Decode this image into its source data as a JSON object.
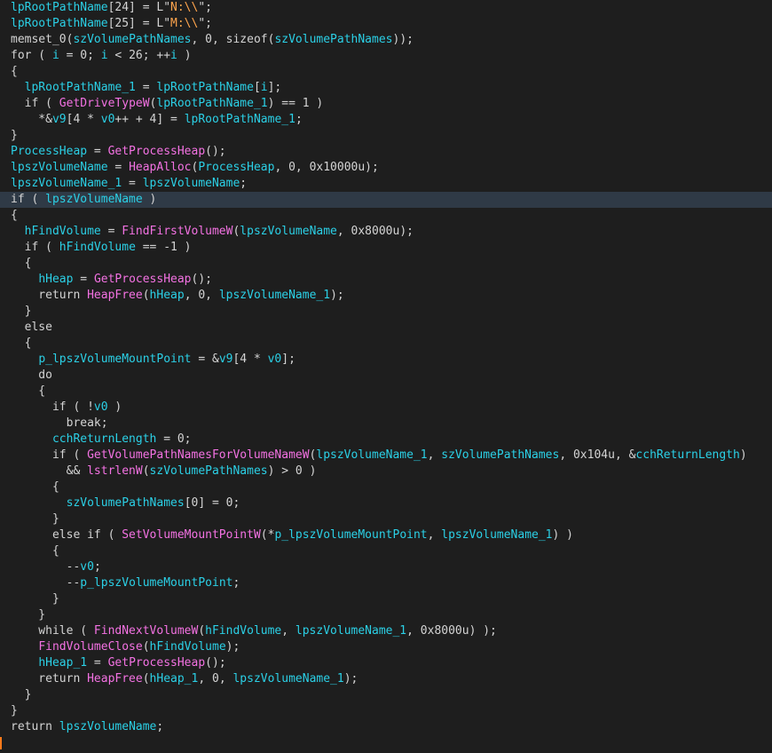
{
  "colors": {
    "background": "#1e1e1e",
    "current_line": "#2f3a46",
    "plain": "#d4d4d4",
    "variable": "#2bd0e6",
    "function": "#f472e3",
    "string": "#ffa54d",
    "caret": "#ff7a1a"
  },
  "current_line_index": 12,
  "code": {
    "lines": [
      [
        [
          "var",
          "lpRootPathName"
        ],
        [
          "plain",
          "[24] = L\""
        ],
        [
          "str",
          "N:\\\\"
        ],
        [
          "plain",
          "\";"
        ]
      ],
      [
        [
          "var",
          "lpRootPathName"
        ],
        [
          "plain",
          "[25] = L\""
        ],
        [
          "str",
          "M:\\\\"
        ],
        [
          "plain",
          "\";"
        ]
      ],
      [
        [
          "plain",
          "memset_0("
        ],
        [
          "var",
          "szVolumePathNames"
        ],
        [
          "plain",
          ", 0, sizeof("
        ],
        [
          "var",
          "szVolumePathNames"
        ],
        [
          "plain",
          "));"
        ]
      ],
      [
        [
          "plain",
          "for ( "
        ],
        [
          "var",
          "i"
        ],
        [
          "plain",
          " = 0; "
        ],
        [
          "var",
          "i"
        ],
        [
          "plain",
          " < 26; ++"
        ],
        [
          "var",
          "i"
        ],
        [
          "plain",
          " )"
        ]
      ],
      [
        [
          "plain",
          "{"
        ]
      ],
      [
        [
          "plain",
          "  "
        ],
        [
          "var",
          "lpRootPathName_1"
        ],
        [
          "plain",
          " = "
        ],
        [
          "var",
          "lpRootPathName"
        ],
        [
          "plain",
          "["
        ],
        [
          "var",
          "i"
        ],
        [
          "plain",
          "];"
        ]
      ],
      [
        [
          "plain",
          "  if ( "
        ],
        [
          "func",
          "GetDriveTypeW"
        ],
        [
          "plain",
          "("
        ],
        [
          "var",
          "lpRootPathName_1"
        ],
        [
          "plain",
          ") == 1 )"
        ]
      ],
      [
        [
          "plain",
          "    *&"
        ],
        [
          "var",
          "v9"
        ],
        [
          "plain",
          "[4 * "
        ],
        [
          "var",
          "v0"
        ],
        [
          "plain",
          "++ + 4] = "
        ],
        [
          "var",
          "lpRootPathName_1"
        ],
        [
          "plain",
          ";"
        ]
      ],
      [
        [
          "plain",
          "}"
        ]
      ],
      [
        [
          "var",
          "ProcessHeap"
        ],
        [
          "plain",
          " = "
        ],
        [
          "func",
          "GetProcessHeap"
        ],
        [
          "plain",
          "();"
        ]
      ],
      [
        [
          "var",
          "lpszVolumeName"
        ],
        [
          "plain",
          " = "
        ],
        [
          "func",
          "HeapAlloc"
        ],
        [
          "plain",
          "("
        ],
        [
          "var",
          "ProcessHeap"
        ],
        [
          "plain",
          ", 0, 0x10000u);"
        ]
      ],
      [
        [
          "var",
          "lpszVolumeName_1"
        ],
        [
          "plain",
          " = "
        ],
        [
          "var",
          "lpszVolumeName"
        ],
        [
          "plain",
          ";"
        ]
      ],
      [
        [
          "plain",
          "if ( "
        ],
        [
          "var",
          "lpszVolumeName"
        ],
        [
          "plain",
          " )"
        ]
      ],
      [
        [
          "plain",
          "{"
        ]
      ],
      [
        [
          "plain",
          "  "
        ],
        [
          "var",
          "hFindVolume"
        ],
        [
          "plain",
          " = "
        ],
        [
          "func",
          "FindFirstVolumeW"
        ],
        [
          "plain",
          "("
        ],
        [
          "var",
          "lpszVolumeName"
        ],
        [
          "plain",
          ", 0x8000u);"
        ]
      ],
      [
        [
          "plain",
          "  if ( "
        ],
        [
          "var",
          "hFindVolume"
        ],
        [
          "plain",
          " == -1 )"
        ]
      ],
      [
        [
          "plain",
          "  {"
        ]
      ],
      [
        [
          "plain",
          "    "
        ],
        [
          "var",
          "hHeap"
        ],
        [
          "plain",
          " = "
        ],
        [
          "func",
          "GetProcessHeap"
        ],
        [
          "plain",
          "();"
        ]
      ],
      [
        [
          "plain",
          "    return "
        ],
        [
          "func",
          "HeapFree"
        ],
        [
          "plain",
          "("
        ],
        [
          "var",
          "hHeap"
        ],
        [
          "plain",
          ", 0, "
        ],
        [
          "var",
          "lpszVolumeName_1"
        ],
        [
          "plain",
          ");"
        ]
      ],
      [
        [
          "plain",
          "  }"
        ]
      ],
      [
        [
          "plain",
          "  else"
        ]
      ],
      [
        [
          "plain",
          "  {"
        ]
      ],
      [
        [
          "plain",
          "    "
        ],
        [
          "var",
          "p_lpszVolumeMountPoint"
        ],
        [
          "plain",
          " = &"
        ],
        [
          "var",
          "v9"
        ],
        [
          "plain",
          "[4 * "
        ],
        [
          "var",
          "v0"
        ],
        [
          "plain",
          "];"
        ]
      ],
      [
        [
          "plain",
          "    do"
        ]
      ],
      [
        [
          "plain",
          "    {"
        ]
      ],
      [
        [
          "plain",
          "      if ( !"
        ],
        [
          "var",
          "v0"
        ],
        [
          "plain",
          " )"
        ]
      ],
      [
        [
          "plain",
          "        break;"
        ]
      ],
      [
        [
          "plain",
          "      "
        ],
        [
          "var",
          "cchReturnLength"
        ],
        [
          "plain",
          " = 0;"
        ]
      ],
      [
        [
          "plain",
          "      if ( "
        ],
        [
          "func",
          "GetVolumePathNamesForVolumeNameW"
        ],
        [
          "plain",
          "("
        ],
        [
          "var",
          "lpszVolumeName_1"
        ],
        [
          "plain",
          ", "
        ],
        [
          "var",
          "szVolumePathNames"
        ],
        [
          "plain",
          ", 0x104u, &"
        ],
        [
          "var",
          "cchReturnLength"
        ],
        [
          "plain",
          ")"
        ]
      ],
      [
        [
          "plain",
          "        && "
        ],
        [
          "func",
          "lstrlenW"
        ],
        [
          "plain",
          "("
        ],
        [
          "var",
          "szVolumePathNames"
        ],
        [
          "plain",
          ") > 0 )"
        ]
      ],
      [
        [
          "plain",
          "      {"
        ]
      ],
      [
        [
          "plain",
          "        "
        ],
        [
          "var",
          "szVolumePathNames"
        ],
        [
          "plain",
          "[0] = 0;"
        ]
      ],
      [
        [
          "plain",
          "      }"
        ]
      ],
      [
        [
          "plain",
          "      else if ( "
        ],
        [
          "func",
          "SetVolumeMountPointW"
        ],
        [
          "plain",
          "(*"
        ],
        [
          "var",
          "p_lpszVolumeMountPoint"
        ],
        [
          "plain",
          ", "
        ],
        [
          "var",
          "lpszVolumeName_1"
        ],
        [
          "plain",
          ") )"
        ]
      ],
      [
        [
          "plain",
          "      {"
        ]
      ],
      [
        [
          "plain",
          "        --"
        ],
        [
          "var",
          "v0"
        ],
        [
          "plain",
          ";"
        ]
      ],
      [
        [
          "plain",
          "        --"
        ],
        [
          "var",
          "p_lpszVolumeMountPoint"
        ],
        [
          "plain",
          ";"
        ]
      ],
      [
        [
          "plain",
          "      }"
        ]
      ],
      [
        [
          "plain",
          "    }"
        ]
      ],
      [
        [
          "plain",
          "    while ( "
        ],
        [
          "func",
          "FindNextVolumeW"
        ],
        [
          "plain",
          "("
        ],
        [
          "var",
          "hFindVolume"
        ],
        [
          "plain",
          ", "
        ],
        [
          "var",
          "lpszVolumeName_1"
        ],
        [
          "plain",
          ", 0x8000u) );"
        ]
      ],
      [
        [
          "plain",
          "    "
        ],
        [
          "func",
          "FindVolumeClose"
        ],
        [
          "plain",
          "("
        ],
        [
          "var",
          "hFindVolume"
        ],
        [
          "plain",
          ");"
        ]
      ],
      [
        [
          "plain",
          "    "
        ],
        [
          "var",
          "hHeap_1"
        ],
        [
          "plain",
          " = "
        ],
        [
          "func",
          "GetProcessHeap"
        ],
        [
          "plain",
          "();"
        ]
      ],
      [
        [
          "plain",
          "    return "
        ],
        [
          "func",
          "HeapFree"
        ],
        [
          "plain",
          "("
        ],
        [
          "var",
          "hHeap_1"
        ],
        [
          "plain",
          ", 0, "
        ],
        [
          "var",
          "lpszVolumeName_1"
        ],
        [
          "plain",
          ");"
        ]
      ],
      [
        [
          "plain",
          "  }"
        ]
      ],
      [
        [
          "plain",
          "}"
        ]
      ],
      [
        [
          "plain",
          "return "
        ],
        [
          "var",
          "lpszVolumeName"
        ],
        [
          "plain",
          ";"
        ]
      ],
      [
        [
          "plain",
          ""
        ]
      ]
    ]
  }
}
